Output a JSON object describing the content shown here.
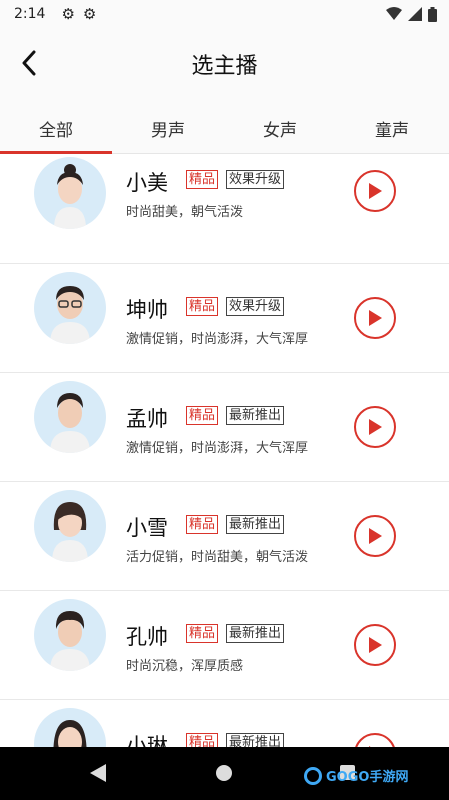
{
  "status_bar": {
    "time": "2:14",
    "left_icons": [
      "gear-icon",
      "gear-icon"
    ],
    "right_icons": [
      "wifi-icon",
      "signal-icon",
      "battery-icon"
    ]
  },
  "header": {
    "title": "选主播",
    "back_icon": "chevron-left-icon"
  },
  "tabs": [
    {
      "label": "全部",
      "active": true
    },
    {
      "label": "男声",
      "active": false
    },
    {
      "label": "女声",
      "active": false
    },
    {
      "label": "童声",
      "active": false
    }
  ],
  "anchors": [
    {
      "name": "小美",
      "tag1": "精品",
      "tag2": "效果升级",
      "desc": "时尚甜美，朝气活泼"
    },
    {
      "name": "坤帅",
      "tag1": "精品",
      "tag2": "效果升级",
      "desc": "激情促销，时尚澎湃，大气浑厚"
    },
    {
      "name": "孟帅",
      "tag1": "精品",
      "tag2": "最新推出",
      "desc": "激情促销，时尚澎湃，大气浑厚"
    },
    {
      "name": "小雪",
      "tag1": "精品",
      "tag2": "最新推出",
      "desc": "活力促销，时尚甜美，朝气活泼"
    },
    {
      "name": "孔帅",
      "tag1": "精品",
      "tag2": "最新推出",
      "desc": "时尚沉稳，浑厚质感"
    },
    {
      "name": "小琳",
      "tag1": "精品",
      "tag2": "最新推出",
      "desc": ""
    }
  ],
  "colors": {
    "accent": "#d9342b",
    "nav": "#000000",
    "avatar_bg": "#d8ebf8"
  },
  "watermark": {
    "text": "GOGO手游网"
  }
}
